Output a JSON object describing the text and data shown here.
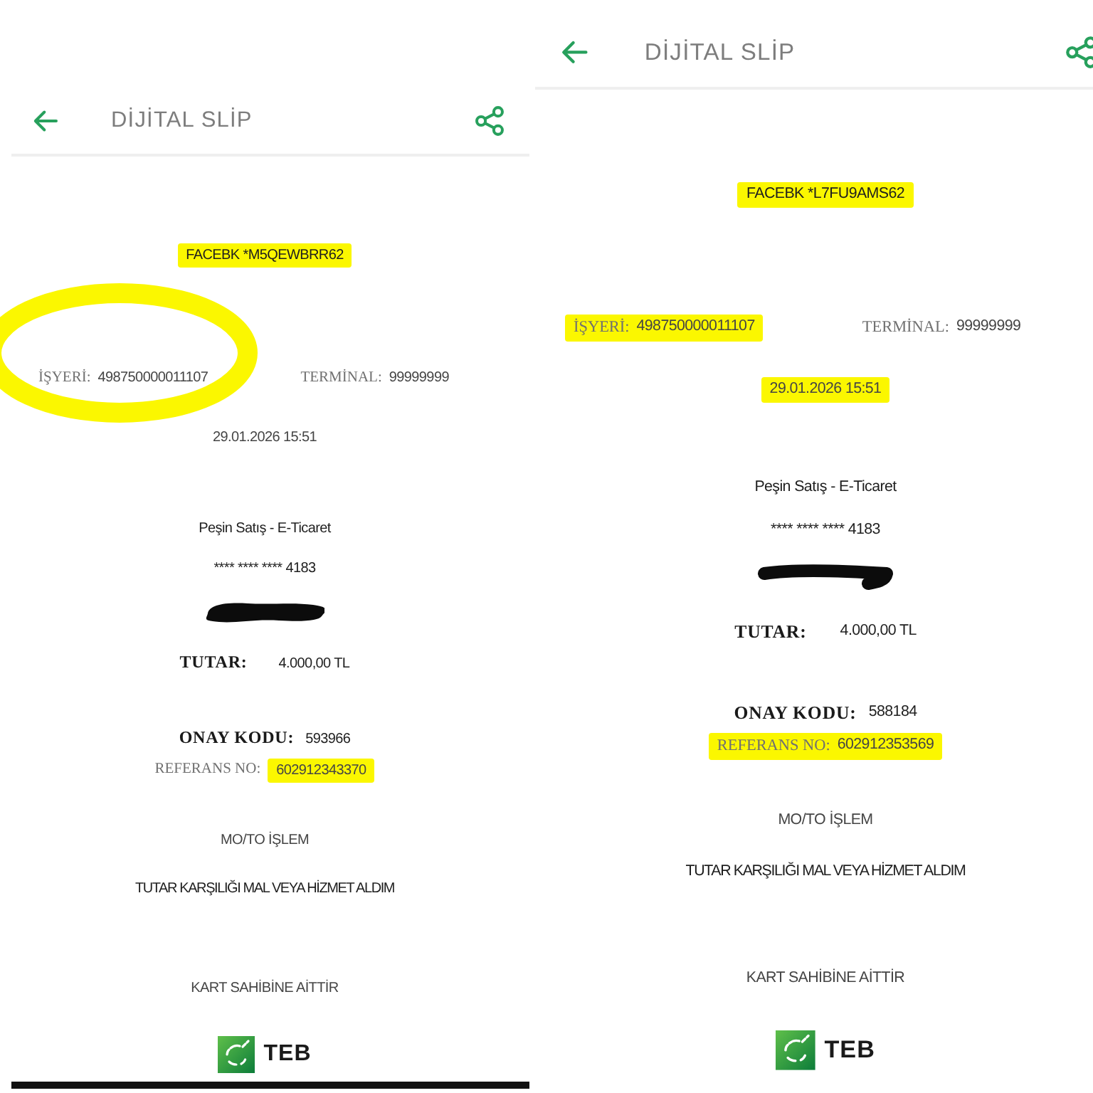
{
  "slips": [
    {
      "header": {
        "title": "DİJİTAL SLİP"
      },
      "merchant": {
        "text": "FACEBK *M5QEWBRR62",
        "highlighted": true
      },
      "merchant_id": {
        "label": "İŞYERİ:",
        "value": "498750000011107",
        "label_highlighted": false,
        "value_highlighted": false,
        "circled": true
      },
      "terminal": {
        "label": "TERMİNAL:",
        "value": "99999999"
      },
      "date": {
        "text": "29.01.2026 15:51",
        "highlighted": false
      },
      "transaction_type": "Peşin Satış - E-Ticaret",
      "card_number": "**** **** **** 4183",
      "cardholder_redacted": true,
      "amount": {
        "label": "TUTAR:",
        "value": "4.000,00 TL"
      },
      "approval_code": {
        "label": "ONAY KODU:",
        "value": "593966"
      },
      "reference_no": {
        "label": "REFERANS NO:",
        "value": "602912343370",
        "label_highlighted": false,
        "value_highlighted": true
      },
      "channel": "MO/TO İŞLEM",
      "statement": "TUTAR KARŞILIĞI MAL VEYA HİZMET ALDIM",
      "copy_note": "KART SAHİBİNE AİTTİR",
      "bank": "TEB",
      "bottom_bar": true
    },
    {
      "header": {
        "title": "DİJİTAL SLİP"
      },
      "merchant": {
        "text": "FACEBK *L7FU9AMS62",
        "highlighted": true
      },
      "merchant_id": {
        "label": "İŞYERİ:",
        "value": "498750000011107",
        "label_highlighted": true,
        "value_highlighted": true,
        "circled": false
      },
      "terminal": {
        "label": "TERMİNAL:",
        "value": "99999999"
      },
      "date": {
        "text": "29.01.2026 15:51",
        "highlighted": true
      },
      "transaction_type": "Peşin Satış - E-Ticaret",
      "card_number": "**** **** **** 4183",
      "cardholder_redacted": true,
      "amount": {
        "label": "TUTAR:",
        "value": "4.000,00 TL"
      },
      "approval_code": {
        "label": "ONAY KODU:",
        "value": "588184"
      },
      "reference_no": {
        "label": "REFERANS NO:",
        "value": "602912353569",
        "label_highlighted": true,
        "value_highlighted": true
      },
      "channel": "MO/TO İŞLEM",
      "statement": "TUTAR KARŞILIĞI MAL VEYA HİZMET ALDIM",
      "copy_note": "KART SAHİBİNE AİTTİR",
      "bank": "TEB",
      "bottom_bar": false
    }
  ]
}
